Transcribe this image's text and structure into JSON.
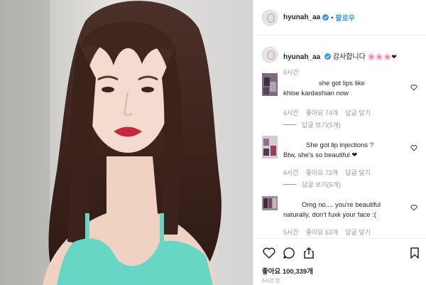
{
  "header": {
    "username": "hyunah_aa",
    "separator": "•",
    "follow_label": "팔로우"
  },
  "caption": {
    "username": "hyunah_aa",
    "text": "감사합니다",
    "emoji_tail": "🌸🌸🌸❤",
    "time": "6시간"
  },
  "comments": [
    {
      "lines": [
        "she got lips like",
        "khloe kardashian now"
      ],
      "time": "6시간",
      "likes": "좋아요 74개",
      "reply": "답글 달기",
      "view_replies": "답글 보기(5개)"
    },
    {
      "lines": [
        "She got lip injections ?",
        "Btw, she's so beautiful ❤"
      ],
      "time": "6시간",
      "likes": "좋아요 72개",
      "reply": "답글 달기",
      "view_replies": "답글 보기(5개)"
    },
    {
      "lines": [
        "Omg no.... you're beautiful",
        "naturally. don't fuxk your face :("
      ],
      "time": "5시간",
      "likes": "좋아요 63개",
      "reply": "답글 달기"
    }
  ],
  "footer": {
    "likes": "좋아요 100,339개",
    "posted": "6시간 전"
  },
  "icons": {
    "heart": "heart-icon",
    "comment": "comment-icon",
    "share": "share-icon",
    "bookmark": "bookmark-icon",
    "verified": "verified-badge-icon"
  },
  "colors": {
    "link": "#3897f0",
    "muted": "#999999",
    "heart": "#d40d3b"
  }
}
